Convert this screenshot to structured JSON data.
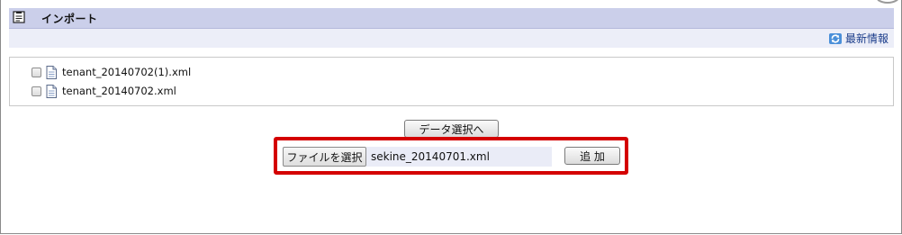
{
  "header": {
    "title": "インポート",
    "icon": "clipboard-icon",
    "bar_color": "#cbcfea"
  },
  "subheader": {
    "refresh_label": "最新情報",
    "refresh_icon": "refresh-icon"
  },
  "files": [
    {
      "name": "tenant_20140702(1).xml",
      "checked": false
    },
    {
      "name": "tenant_20140702.xml",
      "checked": false
    }
  ],
  "actions": {
    "data_select_label": "データ選択へ",
    "choose_file_label": "ファイルを選択",
    "selected_file": "sekine_20140701.xml",
    "add_label": "追 加"
  },
  "highlight_color": "#d40000"
}
